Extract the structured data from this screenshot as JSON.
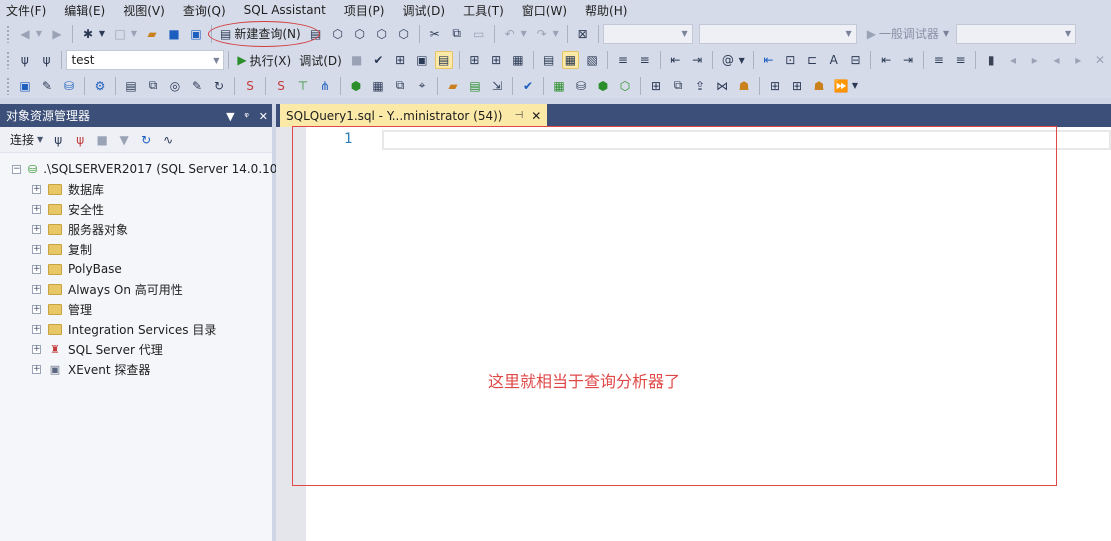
{
  "menu": [
    "文件(F)",
    "编辑(E)",
    "视图(V)",
    "查询(Q)",
    "SQL Assistant",
    "项目(P)",
    "调试(D)",
    "工具(T)",
    "窗口(W)",
    "帮助(H)"
  ],
  "toolbar1": {
    "new_query_label": "新建查询(N)",
    "debugger_combo": "一般调试器"
  },
  "toolbar2": {
    "database_combo": "test",
    "execute_label": "执行(X)",
    "debug_label": "调试(D)"
  },
  "object_explorer": {
    "title": "对象资源管理器",
    "connect_label": "连接",
    "server_node": ".\\SQLSERVER2017 (SQL Server 14.0.10",
    "nodes": [
      {
        "label": "数据库",
        "icon": "folder-icon"
      },
      {
        "label": "安全性",
        "icon": "folder-icon"
      },
      {
        "label": "服务器对象",
        "icon": "folder-icon"
      },
      {
        "label": "复制",
        "icon": "folder-icon"
      },
      {
        "label": "PolyBase",
        "icon": "folder-icon"
      },
      {
        "label": "Always On 高可用性",
        "icon": "folder-icon"
      },
      {
        "label": "管理",
        "icon": "folder-icon"
      },
      {
        "label": "Integration Services 目录",
        "icon": "folder-icon"
      },
      {
        "label": "SQL Server 代理",
        "icon": "agent-icon"
      },
      {
        "label": "XEvent 探查器",
        "icon": "xevent-icon"
      }
    ]
  },
  "document_tab": {
    "title": "SQLQuery1.sql - Y...ministrator (54))"
  },
  "editor": {
    "line_number": "1"
  },
  "annotation": {
    "text": "这里就相当于查询分析器了",
    "color": "#e04848"
  },
  "colors": {
    "chrome": "#d6dbe9",
    "panel_header": "#3c4f78",
    "active_tab": "#fbe9a8",
    "line_number": "#2b7bb8"
  }
}
